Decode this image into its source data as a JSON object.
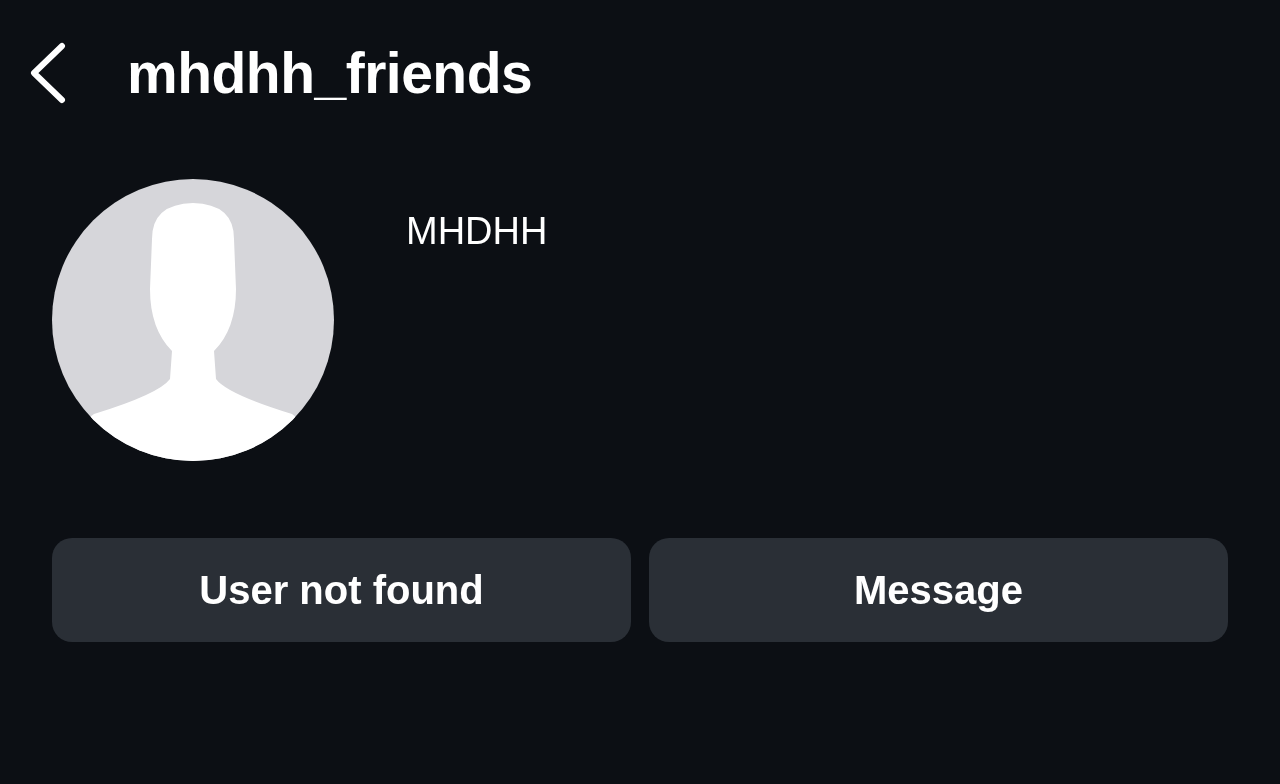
{
  "header": {
    "title": "mhdhh_friends"
  },
  "profile": {
    "name": "MHDHH"
  },
  "buttons": [
    {
      "label": "User not found"
    },
    {
      "label": "Message"
    }
  ]
}
